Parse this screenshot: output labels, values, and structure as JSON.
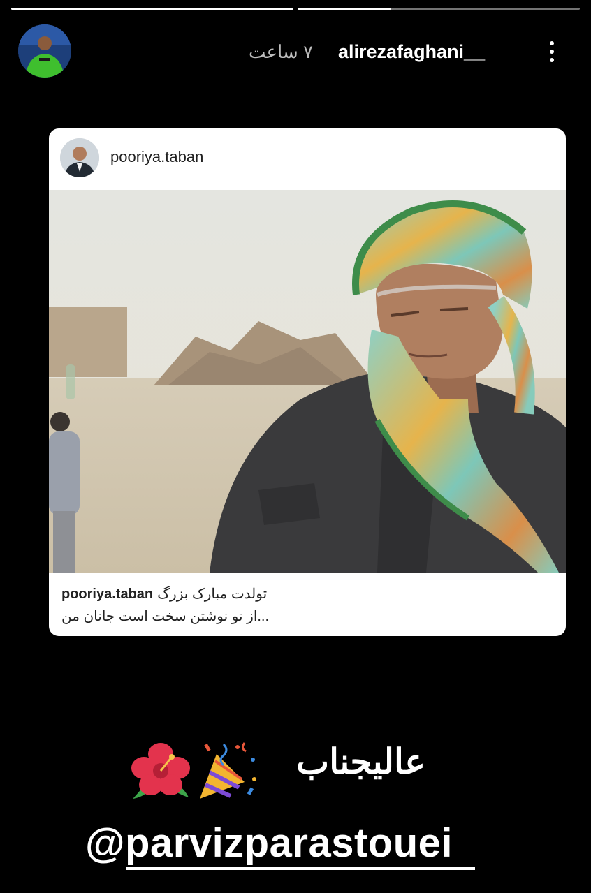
{
  "story": {
    "segments": [
      {
        "progress": 1.0
      },
      {
        "progress": 0.33
      }
    ],
    "header": {
      "username": "alirezafaghani__",
      "time": "۷ ساعت",
      "avatar_icon": "profile-avatar-icon",
      "more_icon": "more-options-icon"
    },
    "post_card": {
      "username": "pooriya.taban",
      "caption_user": "pooriya.taban",
      "caption_line1": "تولدت مبارک بزرگ",
      "caption_line2": "از تو نوشتن سخت است جانان من..."
    },
    "overlay_text": "عالیجناب",
    "mention": "@parvizparastouei",
    "stickers": [
      "hibiscus-emoji",
      "party-popper-emoji"
    ]
  },
  "colors": {
    "background": "#000000",
    "card": "#ffffff",
    "text_secondary": "#bdbdbd"
  }
}
